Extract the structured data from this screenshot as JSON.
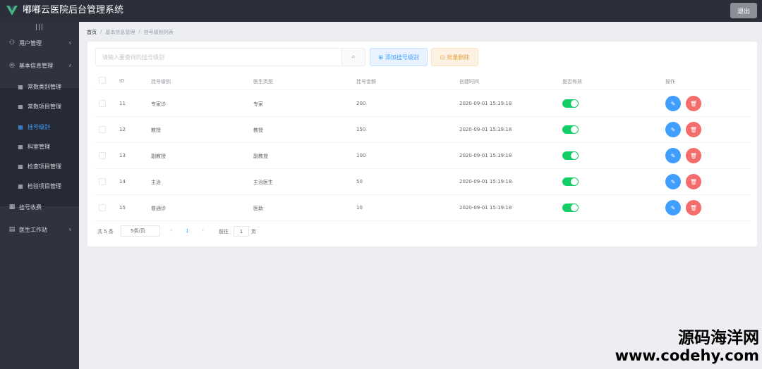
{
  "app": {
    "title": "嘟嘟云医院后台管理系统",
    "logout_label": "退出"
  },
  "colors": {
    "primary": "#409eff",
    "success": "#13ce66",
    "danger": "#f56c6c",
    "warning": "#e6a23c",
    "sidebar_bg": "#2f3340"
  },
  "sidebar": {
    "collapse_icon": "|||",
    "items": [
      {
        "label": "用户管理",
        "icon": "user-icon",
        "glyph": "⚇",
        "has_arrow": true
      },
      {
        "label": "基本信息管理",
        "icon": "settings-icon",
        "glyph": "◎",
        "has_arrow": true
      },
      {
        "label": "常数类别管理",
        "icon": "grid-icon",
        "glyph": "▦"
      },
      {
        "label": "常数项目管理",
        "icon": "grid-icon",
        "glyph": "▦"
      },
      {
        "label": "挂号级别",
        "icon": "grid-icon",
        "glyph": "▦",
        "active": true
      },
      {
        "label": "科室管理",
        "icon": "grid-icon",
        "glyph": "▦"
      },
      {
        "label": "检查项目管理",
        "icon": "grid-icon",
        "glyph": "▦"
      },
      {
        "label": "检验项目管理",
        "icon": "grid-icon",
        "glyph": "▦"
      },
      {
        "label": "挂号收费",
        "icon": "grid-icon",
        "glyph": "▦"
      },
      {
        "label": "医生工作站",
        "icon": "doctor-icon",
        "glyph": "▤",
        "has_arrow": true
      }
    ]
  },
  "breadcrumb": {
    "home": "首页",
    "level1": "基本信息管理",
    "level2": "挂号级别列表",
    "sep": "/"
  },
  "toolbar": {
    "search_placeholder": "请输入要查询的挂号级别",
    "search_icon": "⌕",
    "add_label": "添加挂号级别",
    "add_icon": "⊞",
    "batch_delete_label": "批量删除",
    "batch_delete_icon": "⊡"
  },
  "table": {
    "columns": [
      "ID",
      "挂号级别",
      "医生类型",
      "挂号金额",
      "创建时间",
      "是否有效",
      "操作"
    ],
    "rows": [
      {
        "id": "11",
        "level": "专家诊",
        "doctor_type": "专家",
        "amount": "200",
        "created": "2020-09-01 15:19:18",
        "valid": true
      },
      {
        "id": "12",
        "level": "教授",
        "doctor_type": "教授",
        "amount": "150",
        "created": "2020-09-01 15:19:18",
        "valid": true
      },
      {
        "id": "13",
        "level": "副教授",
        "doctor_type": "副教授",
        "amount": "100",
        "created": "2020-09-01 15:19:18",
        "valid": true
      },
      {
        "id": "14",
        "level": "主治",
        "doctor_type": "主治医生",
        "amount": "50",
        "created": "2020-09-01 15:19:18",
        "valid": true
      },
      {
        "id": "15",
        "level": "普通诊",
        "doctor_type": "医助",
        "amount": "10",
        "created": "2020-09-01 15:19:18",
        "valid": true
      }
    ],
    "edit_icon": "✎",
    "delete_icon": "🗑"
  },
  "pagination": {
    "total": "共 5 条",
    "page_size": "5条/页",
    "prev": "‹",
    "current_page": "1",
    "next": "›",
    "goto_label": "前往",
    "goto_value": "1",
    "page_unit": "页"
  },
  "watermark": {
    "line1": "源码海洋网",
    "line2": "www.codehy.com"
  }
}
